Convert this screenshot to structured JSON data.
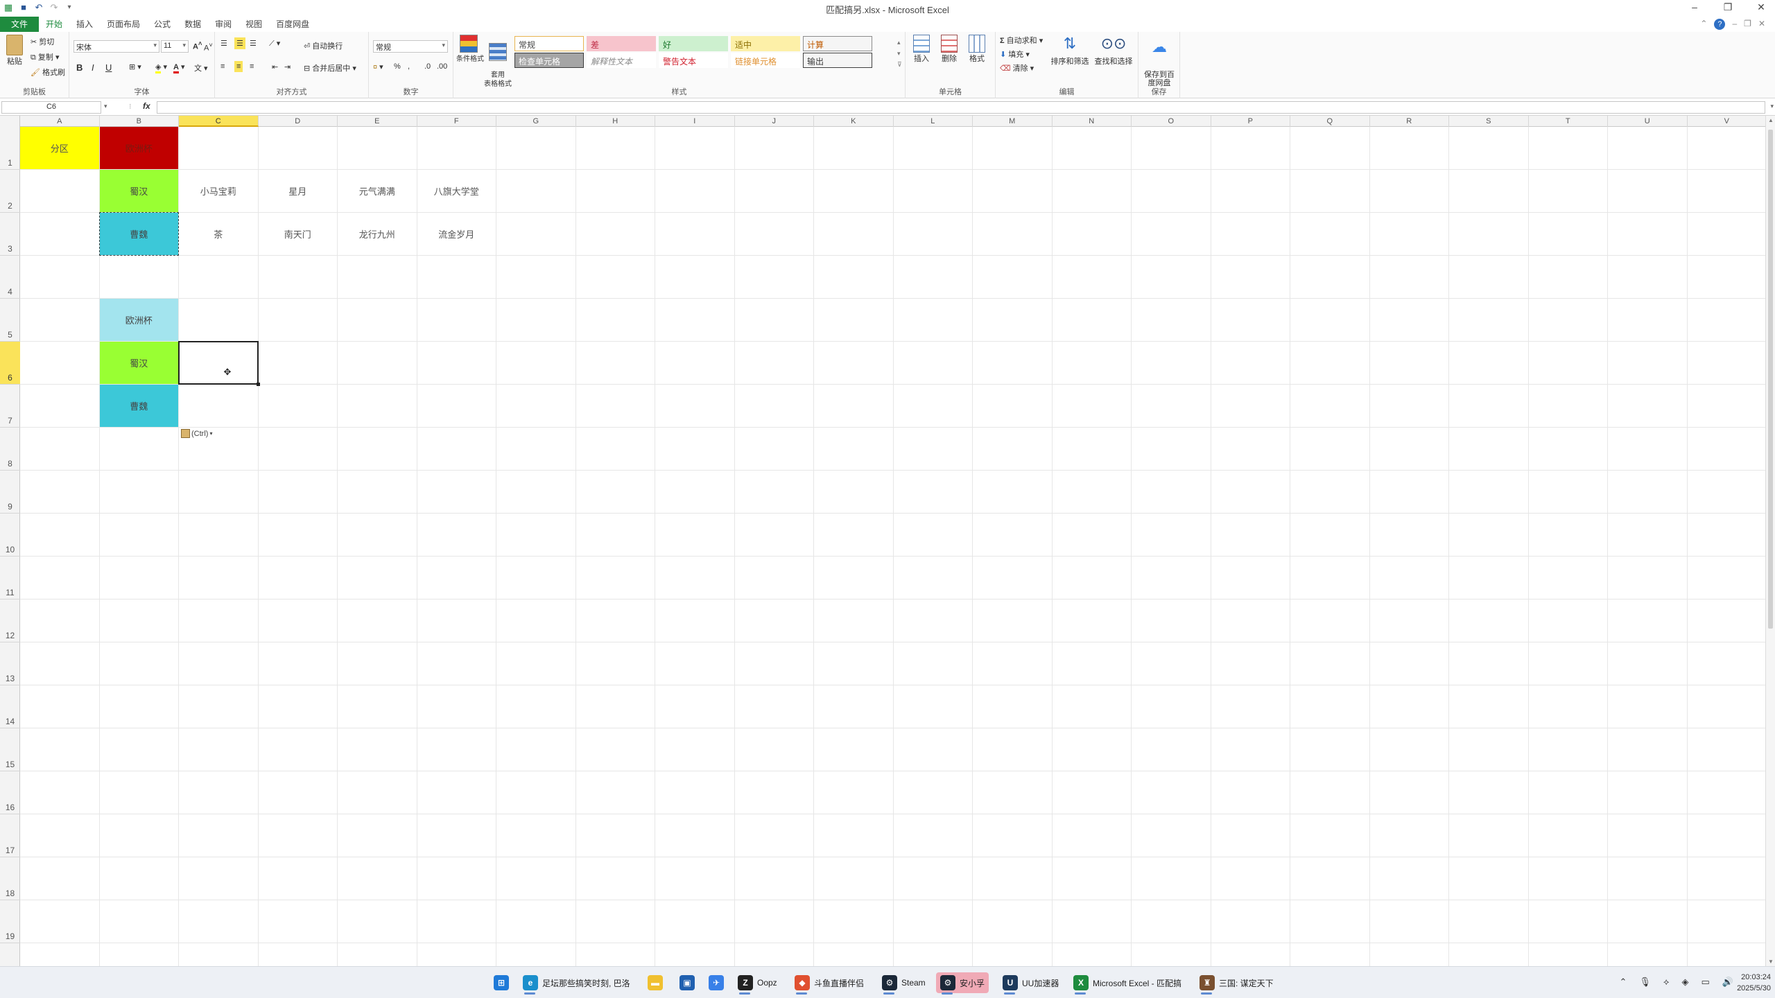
{
  "window": {
    "title": "匹配搞另.xlsx - Microsoft Excel"
  },
  "menu": {
    "tabs": [
      "文件",
      "开始",
      "插入",
      "页面布局",
      "公式",
      "数据",
      "审阅",
      "视图",
      "百度网盘"
    ]
  },
  "ribbon": {
    "clipboard": {
      "paste": "粘贴",
      "cut": "剪切",
      "copy": "复制",
      "format_painter": "格式刷",
      "label": "剪贴板"
    },
    "font": {
      "name": "宋体",
      "size": "11",
      "bold": "B",
      "italic": "I",
      "underline": "U",
      "label": "字体"
    },
    "alignment": {
      "wrap": "自动换行",
      "merge": "合并后居中",
      "label": "对齐方式"
    },
    "number": {
      "format": "常规",
      "percent": "%",
      "label": "数字"
    },
    "styles": {
      "conditional": "条件格式",
      "table": "套用\n表格格式",
      "cells": [
        {
          "text": "常规",
          "bg": "#ffffff",
          "color": "#444444",
          "border": "#e8b450"
        },
        {
          "text": "差",
          "bg": "#f7c4cc",
          "color": "#c0304a",
          "border": "#f7c4cc"
        },
        {
          "text": "好",
          "bg": "#cdf0cf",
          "color": "#1f7a2f",
          "border": "#cdf0cf"
        },
        {
          "text": "适中",
          "bg": "#fdf0a8",
          "color": "#8a6d00",
          "border": "#fdf0a8"
        },
        {
          "text": "计算",
          "bg": "#f5f5f5",
          "color": "#c05a00",
          "border": "#8c8c8c"
        },
        {
          "text": "检查单元格",
          "bg": "#a5a5a5",
          "color": "#ffffff",
          "border": "#3c3c3c"
        },
        {
          "text": "解释性文本",
          "bg": "#ffffff",
          "color": "#8a8a8a",
          "border": "#ffffff"
        },
        {
          "text": "警告文本",
          "bg": "#ffffff",
          "color": "#d0202e",
          "border": "#ffffff"
        },
        {
          "text": "链接单元格",
          "bg": "#ffffff",
          "color": "#e09030",
          "border": "#ffffff"
        },
        {
          "text": "输出",
          "bg": "#f5f5f5",
          "color": "#3a3a3a",
          "border": "#3f3f3f"
        }
      ],
      "label": "样式"
    },
    "cells_group": {
      "insert": "插入",
      "delete": "删除",
      "format": "格式",
      "label": "单元格"
    },
    "editing": {
      "autosum": "自动求和",
      "fill": "填充",
      "clear": "清除",
      "sort": "排序和筛选",
      "find": "查找和选择",
      "label": "编辑"
    },
    "save": {
      "cloud": "保存到百\n度网盘",
      "label": "保存"
    }
  },
  "formula_bar": {
    "name_box": "C6",
    "fx": "fx",
    "value": ""
  },
  "grid": {
    "selected_col": "C",
    "selected_row": "6",
    "columns": [
      "A",
      "B",
      "C",
      "D",
      "E",
      "F",
      "G",
      "H",
      "I",
      "J",
      "K",
      "L",
      "M",
      "N",
      "O",
      "P",
      "Q",
      "R",
      "S",
      "T",
      "U",
      "V"
    ],
    "rows": [
      "1",
      "2",
      "3",
      "4",
      "5",
      "6",
      "7",
      "8",
      "9",
      "10",
      "11",
      "12",
      "13",
      "14",
      "15",
      "16",
      "17",
      "18",
      "19"
    ],
    "cells": [
      {
        "ref": "A1",
        "text": "分区",
        "bg": "#ffff00",
        "color": "#555555"
      },
      {
        "ref": "B1",
        "text": "欧洲杯",
        "bg": "#c00000",
        "color": "#7a1a10"
      },
      {
        "ref": "B2",
        "text": "蜀汉",
        "bg": "#99ff33",
        "color": "#444444"
      },
      {
        "ref": "C2",
        "text": "小马宝莉",
        "bg": "",
        "color": "#555555"
      },
      {
        "ref": "D2",
        "text": "星月",
        "bg": "",
        "color": "#555555"
      },
      {
        "ref": "E2",
        "text": "元气满满",
        "bg": "",
        "color": "#555555"
      },
      {
        "ref": "F2",
        "text": "八旗大学堂",
        "bg": "",
        "color": "#555555"
      },
      {
        "ref": "B3",
        "text": "曹魏",
        "bg": "#3cc8d8",
        "color": "#444444"
      },
      {
        "ref": "C3",
        "text": "茶",
        "bg": "",
        "color": "#555555"
      },
      {
        "ref": "D3",
        "text": "南天门",
        "bg": "",
        "color": "#555555"
      },
      {
        "ref": "E3",
        "text": "龙行九州",
        "bg": "",
        "color": "#555555"
      },
      {
        "ref": "F3",
        "text": "流金岁月",
        "bg": "",
        "color": "#555555"
      },
      {
        "ref": "B5",
        "text": "欧洲杯",
        "bg": "#a3e4ee",
        "color": "#444444"
      },
      {
        "ref": "B6",
        "text": "蜀汉",
        "bg": "#99ff33",
        "color": "#444444"
      },
      {
        "ref": "B7",
        "text": "曹魏",
        "bg": "#3cc8d8",
        "color": "#444444"
      }
    ],
    "paste_options": "(Ctrl)"
  },
  "taskbar": {
    "items": [
      {
        "label": "",
        "icon": "windows-start-icon",
        "color": "#1f7ad8"
      },
      {
        "label": "足坛那些搞笑时刻, 巴洛",
        "icon": "edge-icon",
        "color": "#1a8fcc"
      },
      {
        "label": "",
        "icon": "folder-icon",
        "color": "#f0c030"
      },
      {
        "label": "",
        "icon": "store-icon",
        "color": "#2060b0"
      },
      {
        "label": "",
        "icon": "feishu-icon",
        "color": "#3880e8"
      },
      {
        "label": "Oopz",
        "icon": "oopz-icon",
        "color": "#222222"
      },
      {
        "label": "斗鱼直播伴侣",
        "icon": "douyu-icon",
        "color": "#e05030"
      },
      {
        "label": "Steam",
        "icon": "steam-icon",
        "color": "#1b2838"
      },
      {
        "label": "安小孚",
        "icon": "steam-icon",
        "color": "#1b2838"
      },
      {
        "label": "UU加速器",
        "icon": "uu-icon",
        "color": "#1d3a5c"
      },
      {
        "label": "Microsoft Excel - 匹配搞",
        "icon": "excel-icon",
        "color": "#1e8b3e"
      },
      {
        "label": "三国: 谋定天下",
        "icon": "game-icon",
        "color": "#7a5030"
      }
    ],
    "time": "20:03:24",
    "date": "2025/5/30"
  }
}
